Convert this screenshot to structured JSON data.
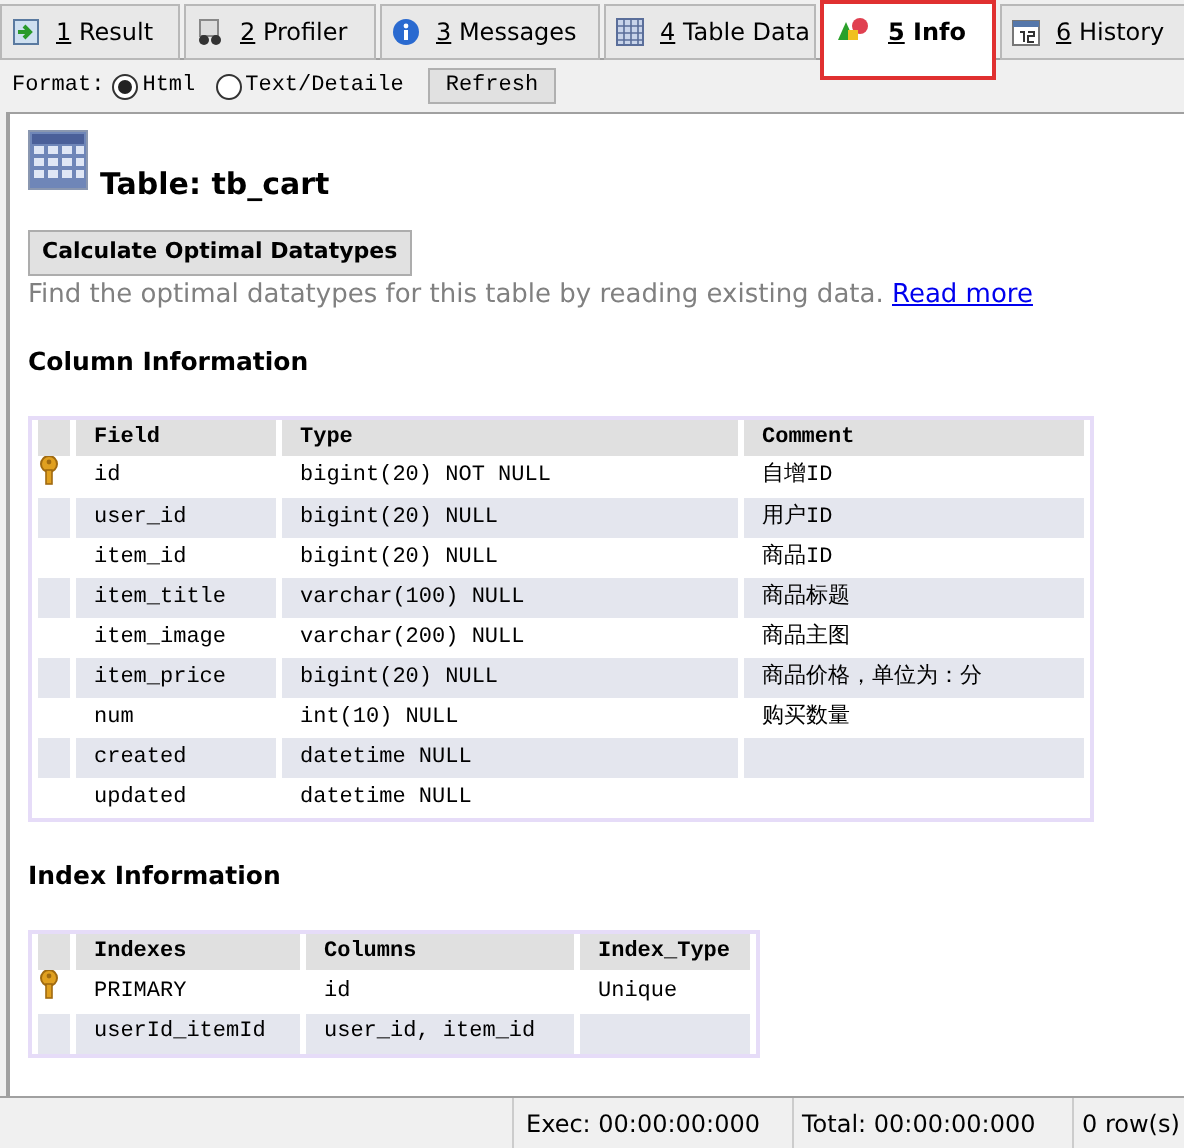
{
  "tabs": [
    {
      "number": "1",
      "label": "Result",
      "selected": false
    },
    {
      "number": "2",
      "label": "Profiler",
      "selected": false
    },
    {
      "number": "3",
      "label": "Messages",
      "selected": false
    },
    {
      "number": "4",
      "label": "Table Data",
      "selected": false
    },
    {
      "number": "5",
      "label": "Info",
      "selected": true
    },
    {
      "number": "6",
      "label": "History",
      "selected": false
    }
  ],
  "format": {
    "label": "Format:",
    "options": [
      {
        "label": "Html",
        "selected": true
      },
      {
        "label": "Text/Detaile",
        "selected": false
      }
    ],
    "refresh": "Refresh"
  },
  "title": "Table: tb_cart",
  "calculate_button": "Calculate Optimal Datatypes",
  "description": "Find the optimal datatypes for this table by reading existing data.",
  "read_more": "Read more",
  "column_info": {
    "heading": "Column Information",
    "columns": [
      "Field",
      "Type",
      "Comment"
    ],
    "rows": [
      {
        "primary_key": true,
        "cells": [
          "id",
          "bigint(20) NOT NULL",
          "自增ID"
        ]
      },
      {
        "primary_key": false,
        "cells": [
          "user_id",
          "bigint(20) NULL",
          "用户ID"
        ]
      },
      {
        "primary_key": false,
        "cells": [
          "item_id",
          "bigint(20) NULL",
          "商品ID"
        ]
      },
      {
        "primary_key": false,
        "cells": [
          "item_title",
          "varchar(100) NULL",
          "商品标题"
        ]
      },
      {
        "primary_key": false,
        "cells": [
          "item_image",
          "varchar(200) NULL",
          "商品主图"
        ]
      },
      {
        "primary_key": false,
        "cells": [
          "item_price",
          "bigint(20) NULL",
          "商品价格，单位为：分"
        ]
      },
      {
        "primary_key": false,
        "cells": [
          "num",
          "int(10) NULL",
          "购买数量"
        ]
      },
      {
        "primary_key": false,
        "cells": [
          "created",
          "datetime NULL",
          ""
        ]
      },
      {
        "primary_key": false,
        "cells": [
          "updated",
          "datetime NULL",
          ""
        ]
      }
    ]
  },
  "index_info": {
    "heading": "Index Information",
    "columns": [
      "Indexes",
      "Columns",
      "Index_Type"
    ],
    "rows": [
      {
        "primary_key": true,
        "cells": [
          "PRIMARY",
          "id",
          "Unique"
        ]
      },
      {
        "primary_key": false,
        "cells": [
          "userId_itemId",
          "user_id, item_id",
          ""
        ]
      }
    ]
  },
  "status_bar": {
    "exec": "Exec: 00:00:00:000",
    "total": "Total: 00:00:00:000",
    "rows": "0 row(s)"
  }
}
